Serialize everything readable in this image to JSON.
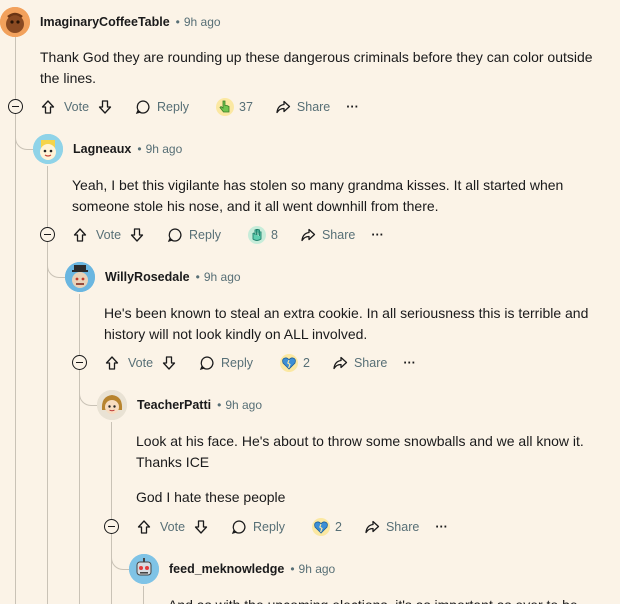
{
  "labels": {
    "vote": "Vote",
    "reply": "Reply",
    "share": "Share",
    "more": "···",
    "separator": "•"
  },
  "comments": [
    {
      "username": "ImaginaryCoffeeTable",
      "time": "9h ago",
      "body": [
        "Thank God they are rounding up these dangerous criminals before they can color outside the lines."
      ],
      "award_count": "37",
      "award_icon": "pointing-hand-award-icon"
    },
    {
      "username": "Lagneaux",
      "time": "9h ago",
      "body": [
        "Yeah, I bet this vigilante has stolen so many grandma kisses. It all started when someone stole his nose, and it all went downhill from there."
      ],
      "award_count": "8",
      "award_icon": "hand-award-icon"
    },
    {
      "username": "WillyRosedale",
      "time": "9h ago",
      "body": [
        "He's been known to steal an extra cookie. In all seriousness this is terrible and history will not look kindly on ALL involved."
      ],
      "award_count": "2",
      "award_icon": "broken-heart-award-icon"
    },
    {
      "username": "TeacherPatti",
      "time": "9h ago",
      "body": [
        "Look at his face. He's about to throw some snowballs and we all know it. Thanks ICE",
        "God I hate these people"
      ],
      "award_count": "2",
      "award_icon": "broken-heart-award-icon"
    },
    {
      "username": "feed_meknowledge",
      "time": "9h ago",
      "body": [
        "And as with the upcoming elections, it's as important as ever to be"
      ]
    }
  ],
  "colors": {
    "background": "#fbf3e7",
    "thread_line": "#c9c2b6",
    "meta_text": "#576f76"
  }
}
